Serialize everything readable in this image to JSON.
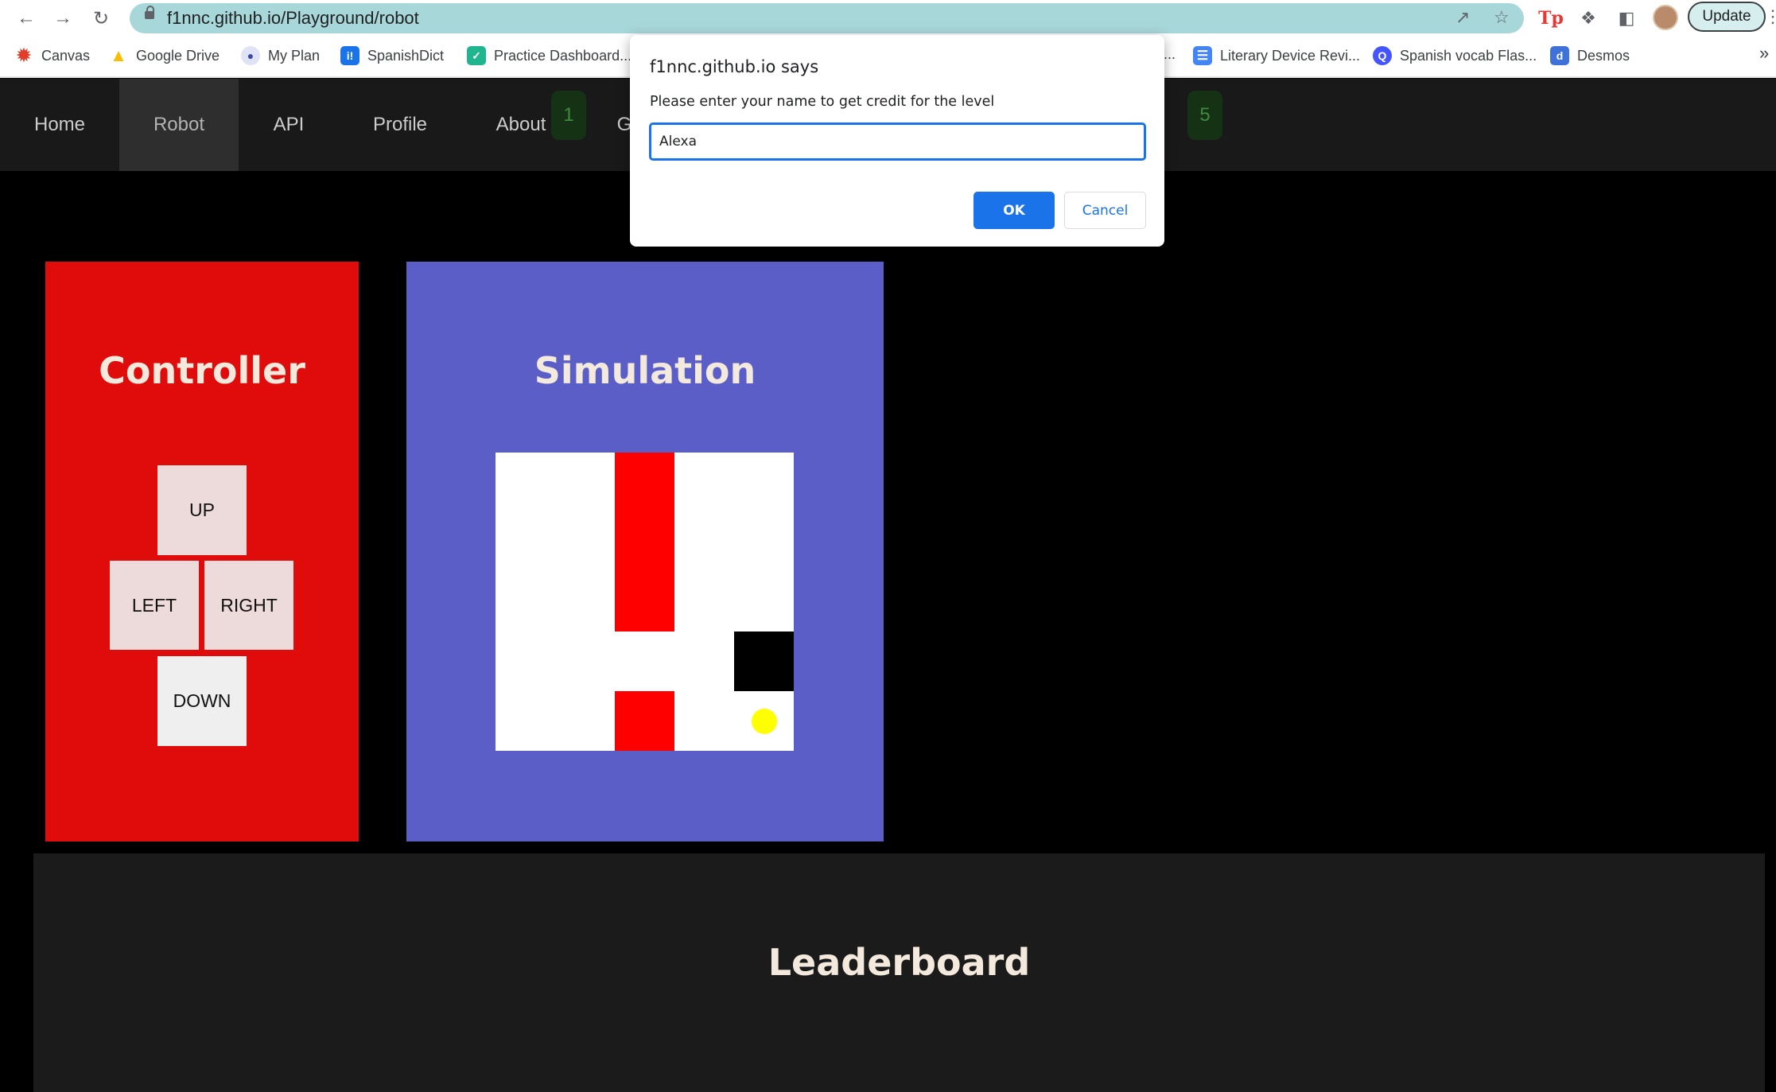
{
  "browser": {
    "url": "f1nnc.github.io/Playground/robot",
    "update_label": "Update",
    "overflow_label": "»",
    "bookmarks": [
      {
        "label": "Canvas",
        "icon": "canvas-icon"
      },
      {
        "label": "Google Drive",
        "icon": "google-drive-icon"
      },
      {
        "label": "My Plan",
        "icon": "my-plan-icon"
      },
      {
        "label": "SpanishDict",
        "icon": "spanishdict-icon"
      },
      {
        "label": "Practice Dashboard...",
        "icon": "practice-dashboard-icon"
      },
      {
        "label": "...",
        "icon": ""
      },
      {
        "label": "Literary Device Revi...",
        "icon": "docs-icon"
      },
      {
        "label": "Spanish vocab Flas...",
        "icon": "quizlet-icon"
      },
      {
        "label": "Desmos",
        "icon": "desmos-icon"
      }
    ]
  },
  "site_nav": {
    "items": [
      "Home",
      "Robot",
      "API",
      "Profile",
      "About"
    ],
    "active": "Robot",
    "partial_item": "G",
    "pills": [
      "1",
      "5"
    ]
  },
  "controller": {
    "title": "Controller",
    "up": "UP",
    "left": "LEFT",
    "right": "RIGHT",
    "down": "DOWN"
  },
  "simulation": {
    "title": "Simulation",
    "grid_size": 5,
    "walls_color": "#ff0000",
    "goal_color": "#000000",
    "robot_color": "#ffff00"
  },
  "leaderboard": {
    "title": "Leaderboard"
  },
  "dialog": {
    "title": "f1nnc.github.io says",
    "message": "Please enter your name to get credit for the level",
    "input_value": "Alexa",
    "ok_label": "OK",
    "cancel_label": "Cancel"
  },
  "colors": {
    "controller_bg": "#e00b0b",
    "simulation_bg": "#5b5ec7",
    "accent": "#1a73e8"
  }
}
